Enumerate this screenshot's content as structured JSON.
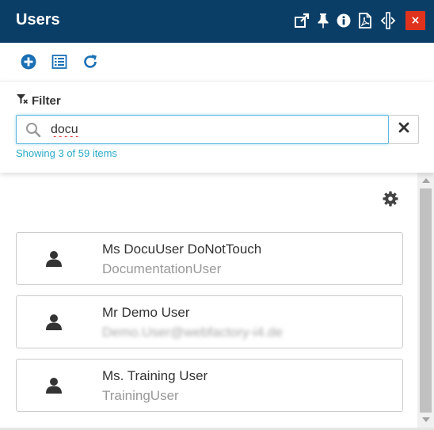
{
  "header": {
    "title": "Users",
    "icons": [
      "popout-icon",
      "pin-icon",
      "info-icon",
      "pdf-icon",
      "resize-width-icon"
    ],
    "close_label": "×",
    "background": "#0b3e66",
    "close_color": "#e0331e"
  },
  "toolbar": {
    "icons": [
      "add-icon",
      "list-icon",
      "refresh-icon"
    ],
    "accent": "#1a6fb5"
  },
  "filter": {
    "label": "Filter",
    "search_value": "docu",
    "status": "Showing 3 of 59 items"
  },
  "users": [
    {
      "name": "Ms DocuUser DoNotTouch",
      "sub": "DocumentationUser",
      "sub_blurred": false
    },
    {
      "name": "Mr Demo User",
      "sub": "Demo.User@webfactory-i4.de",
      "sub_blurred": true
    },
    {
      "name": "Ms. Training User",
      "sub": "TrainingUser",
      "sub_blurred": false
    }
  ]
}
